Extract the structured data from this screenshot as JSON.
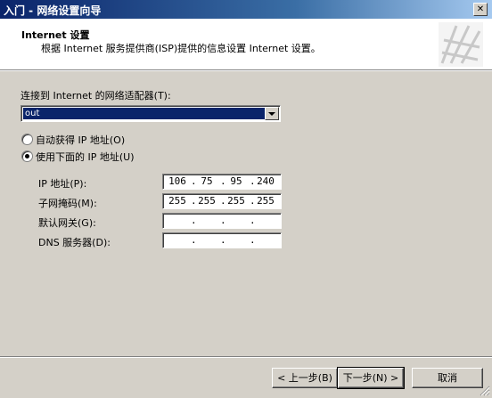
{
  "window": {
    "title": "入门 - 网络设置向导",
    "close_symbol": "✕"
  },
  "header": {
    "title": "Internet 设置",
    "description": "根据 Internet 服务提供商(ISP)提供的信息设置 Internet 设置。"
  },
  "adapter": {
    "label": "连接到 Internet 的网络适配器(T):",
    "selected": "out"
  },
  "ip_mode": {
    "auto_label": "自动获得 IP 地址(O)",
    "manual_label": "使用下面的 IP 地址(U)",
    "selected": "manual"
  },
  "fields": {
    "ip": {
      "label": "IP 地址(P):",
      "octets": [
        "106",
        "75",
        "95",
        "240"
      ]
    },
    "mask": {
      "label": "子网掩码(M):",
      "octets": [
        "255",
        "255",
        "255",
        "255"
      ]
    },
    "gateway": {
      "label": "默认网关(G):",
      "octets": [
        "",
        "",
        "",
        ""
      ]
    },
    "dns": {
      "label": "DNS 服务器(D):",
      "octets": [
        "",
        "",
        "",
        ""
      ]
    },
    "separator": "."
  },
  "buttons": {
    "back": "< 上一步(B)",
    "next": "下一步(N) >",
    "cancel": "取消"
  }
}
